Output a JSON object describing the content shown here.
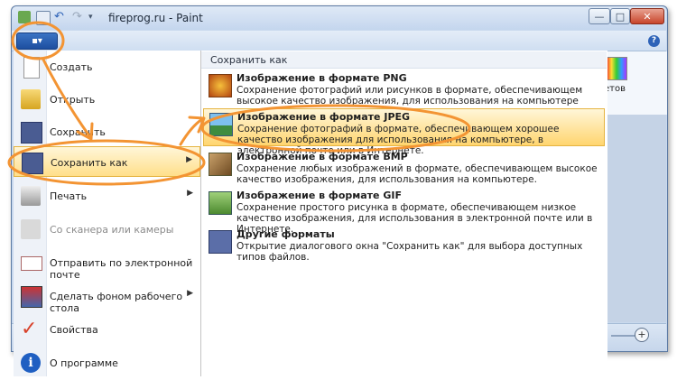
{
  "window": {
    "title": "fireprog.ru - Paint",
    "min": "—",
    "max": "□",
    "close": "✕",
    "help": "?"
  },
  "file_button": {
    "label": "▪▾"
  },
  "left_menu": {
    "items": [
      {
        "label": "Создать",
        "icon": "new-file-icon"
      },
      {
        "label": "Открыть",
        "icon": "open-folder-icon"
      },
      {
        "label": "Сохранить",
        "icon": "save-disk-icon"
      },
      {
        "label": "Сохранить как",
        "icon": "save-as-icon",
        "arrow": "▶"
      },
      {
        "label": "Печать",
        "icon": "printer-icon",
        "arrow": "▶"
      },
      {
        "label": "Со сканера или камеры",
        "icon": "scanner-icon"
      },
      {
        "label": "Отправить по электронной почте",
        "icon": "email-icon"
      },
      {
        "label": "Сделать фоном рабочего стола",
        "icon": "desktop-icon",
        "arrow": "▶"
      },
      {
        "label": "Свойства",
        "icon": "checkmark-icon"
      },
      {
        "label": "О программе",
        "icon": "info-icon"
      }
    ]
  },
  "submenu": {
    "header": "Сохранить как",
    "items": [
      {
        "title": "Изображение в формате PNG",
        "desc": "Сохранение фотографий или рисунков в формате, обеспечивающем высокое качество изображения, для использования на компьютере или в Интернете.",
        "icon": "png-image-icon"
      },
      {
        "title": "Изображение в формате JPEG",
        "desc": "Сохранение фотографий в формате, обеспечивающем хорошее качество изображения для использования на компьютере, в электронной почте или в Интернете.",
        "icon": "jpeg-image-icon"
      },
      {
        "title": "Изображение в формате BMP",
        "desc": "Сохранение любых изображений в формате, обеспечивающем высокое качество изображения, для использования на компьютере.",
        "icon": "bmp-image-icon"
      },
      {
        "title": "Изображение в формате GIF",
        "desc": "Сохранение простого рисунка в формате, обеспечивающем низкое качество изображения, для использования в электронной почте или в Интернете.",
        "icon": "gif-image-icon"
      },
      {
        "title": "Другие форматы",
        "desc": "Открытие диалогового окна \"Сохранить как\" для выбора доступных типов файлов.",
        "icon": "other-formats-icon"
      }
    ]
  },
  "ribbon_fragment": {
    "text": "етов"
  },
  "colors": {
    "accent": "#1d4fa0",
    "highlight": "#ffd56f",
    "annotation": "#f39433"
  }
}
